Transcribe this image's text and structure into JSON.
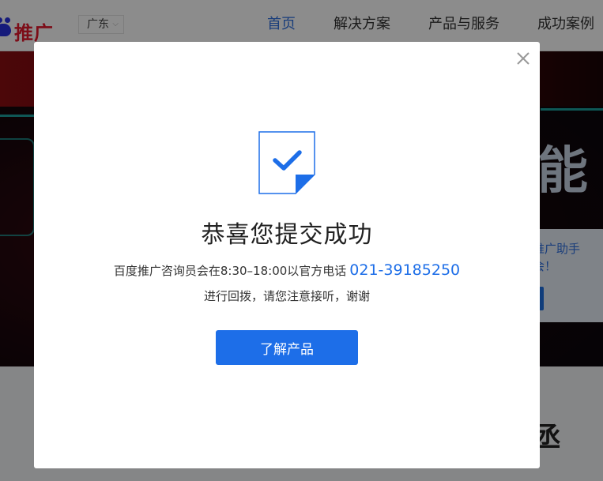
{
  "logo": {
    "text": "推广"
  },
  "region": {
    "value": "广东"
  },
  "nav": {
    "items": [
      {
        "label": "首页"
      },
      {
        "label": "解决方案"
      },
      {
        "label": "产品与服务"
      },
      {
        "label": "成功案例"
      }
    ]
  },
  "hero": {
    "big_text": "能",
    "card_line1": "推广助手",
    "card_line2": "会！"
  },
  "section": {
    "glyph": "丞"
  },
  "modal": {
    "title": "恭喜您提交成功",
    "message_prefix": "百度推广咨询员会在8:30–18:00以官方电话",
    "phone": "021-39185250",
    "message_suffix": "进行回拨，请您注意接听，谢谢",
    "button_label": "了解产品"
  },
  "colors": {
    "accent": "#1d6ee8",
    "nav_active": "#2f6fe0",
    "brand_red": "#e3182d",
    "overlay": "rgba(0,0,0,0.45)"
  },
  "icons": {
    "close": "close-icon",
    "success": "document-check-icon",
    "region_caret": "chevron-down-icon"
  }
}
